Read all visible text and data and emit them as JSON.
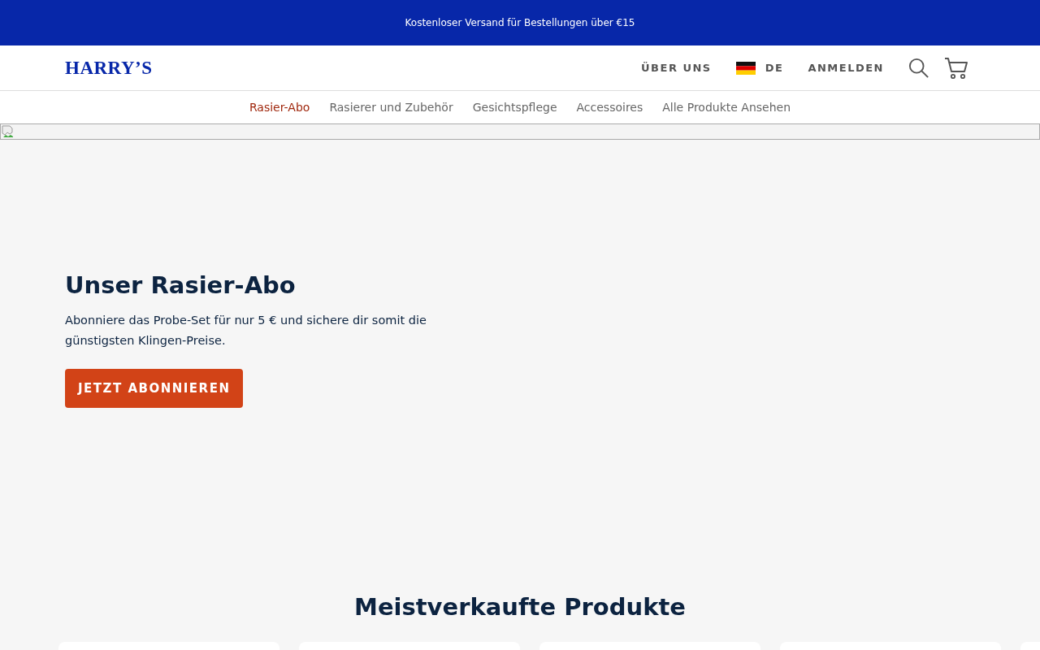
{
  "promo_bar": {
    "text": "Kostenloser Versand für Bestellungen über €15"
  },
  "header": {
    "logo": "HARRY’S",
    "links": [
      {
        "kind": "link",
        "label": "ÜBER UNS"
      },
      {
        "kind": "language",
        "label": "DE"
      },
      {
        "kind": "link",
        "label": "ANMELDEN"
      }
    ]
  },
  "nav": [
    {
      "label": "Rasier-Abo",
      "selected": true
    },
    {
      "label": "Rasierer und Zubehör",
      "selected": false
    },
    {
      "label": "Gesichtspflege",
      "selected": false
    },
    {
      "label": "Accessoires",
      "selected": false
    },
    {
      "label": "Alle Produkte Ansehen",
      "selected": false
    }
  ],
  "hero": {
    "title": "Unser Rasier-Abo",
    "text": "Abonniere das Probe-Set für nur 5 € und sichere dir somit die günstigsten Klingen-Preise.",
    "button": "JETZT ABONNIEREN"
  },
  "bestsellers": {
    "title": "Meistverkaufte Produkte",
    "cards": [
      {
        "kind": "card"
      },
      {
        "kind": "card"
      },
      {
        "kind": "card"
      },
      {
        "kind": "card"
      },
      {
        "kind": "card"
      }
    ]
  }
}
